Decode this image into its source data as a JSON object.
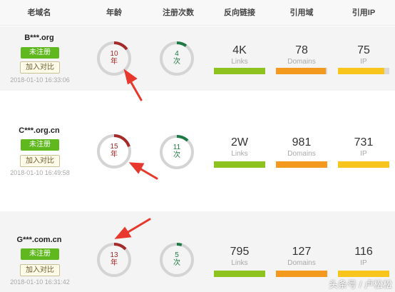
{
  "table": {
    "headers": [
      "老域名",
      "年龄",
      "注册次数",
      "反向链接",
      "引用域",
      "引用IP"
    ],
    "rows": [
      {
        "domain": "B***.org",
        "status": "未注册",
        "compare_label": "加入对比",
        "timestamp": "2018-01-10 16:33:06",
        "age_value": "10",
        "age_unit": "年",
        "reg_value": "4",
        "reg_unit": "次",
        "links_value": "4K",
        "links_label": "Links",
        "domains_value": "78",
        "domains_label": "Domains",
        "ip_value": "75",
        "ip_label": "IP"
      },
      {
        "domain": "C***.org.cn",
        "status": "未注册",
        "compare_label": "加入对比",
        "timestamp": "2018-01-10 16:49:58",
        "age_value": "15",
        "age_unit": "年",
        "reg_value": "11",
        "reg_unit": "次",
        "links_value": "2W",
        "links_label": "Links",
        "domains_value": "981",
        "domains_label": "Domains",
        "ip_value": "731",
        "ip_label": "IP"
      },
      {
        "domain": "G***.com.cn",
        "status": "未注册",
        "compare_label": "加入对比",
        "timestamp": "2018-01-10 16:31:42",
        "age_value": "13",
        "age_unit": "年",
        "reg_value": "5",
        "reg_unit": "次",
        "links_value": "795",
        "links_label": "Links",
        "domains_value": "127",
        "domains_label": "Domains",
        "ip_value": "116",
        "ip_label": "IP"
      }
    ]
  },
  "ring_levels": {
    "age": [
      0.15,
      0.2,
      0.13
    ],
    "registrations": [
      0.1,
      0.12,
      0.05
    ]
  },
  "bar_levels": {
    "links": [
      1.0,
      1.0,
      1.0
    ],
    "domains": [
      0.97,
      1.0,
      1.0
    ],
    "ip": [
      0.9,
      1.0,
      1.0
    ]
  },
  "colors": {
    "status_green": "#5fb81e",
    "age_ring": "#a52a2a",
    "reg_ring": "#1e7a45",
    "ring_track": "#d4d4d4",
    "links_bar": "#8dc21f",
    "domains_bar": "#f39a1e",
    "ip_bar": "#f7c51c",
    "annotation_arrow": "#e8382e"
  },
  "watermark": "头条号 / 卢松松"
}
